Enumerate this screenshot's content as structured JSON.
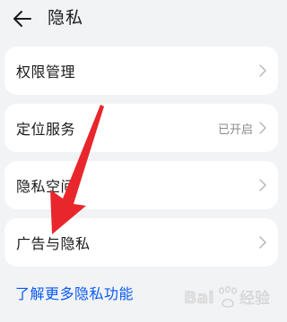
{
  "header": {
    "back_icon": "arrow-left-icon",
    "title": "隐私"
  },
  "items": [
    {
      "label": "权限管理",
      "value": ""
    },
    {
      "label": "定位服务",
      "value": "已开启"
    },
    {
      "label": "隐私空间",
      "value": ""
    },
    {
      "label": "广告与隐私",
      "value": ""
    }
  ],
  "more_link": "了解更多隐私功能",
  "colors": {
    "background": "#F1F3F5",
    "card": "#FFFFFF",
    "link": "#0A59F7",
    "annotation_arrow": "#E8262C"
  },
  "watermark": {
    "kind": "logo",
    "text": "Bai 经验"
  }
}
